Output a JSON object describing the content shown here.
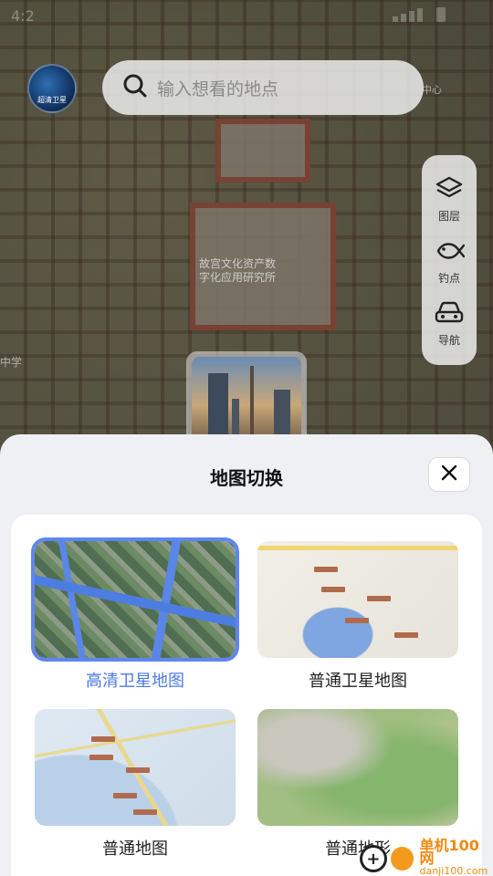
{
  "status": {
    "time": "4:2"
  },
  "map": {
    "label_line1": "故宫文化资产数",
    "label_line2": "字化应用研究所",
    "side_label": "中学",
    "corner_label": "中心"
  },
  "avatar": {
    "label": "超清卫星"
  },
  "search": {
    "placeholder": "输入想看的地点",
    "icon": "search-icon"
  },
  "tools": [
    {
      "label": "图层",
      "icon": "layers-icon"
    },
    {
      "label": "钓点",
      "icon": "fish-icon"
    },
    {
      "label": "导航",
      "icon": "car-icon"
    }
  ],
  "sheet": {
    "title": "地图切换",
    "close_icon": "close-icon",
    "options": [
      {
        "label": "高清卫星地图",
        "selected": true
      },
      {
        "label": "普通卫星地图",
        "selected": false
      },
      {
        "label": "普通地图",
        "selected": false
      },
      {
        "label": "普通地形",
        "selected": false
      }
    ]
  },
  "watermark": {
    "name": "单机100网",
    "url": "danji100.com",
    "logo_char": "+"
  },
  "colors": {
    "accent": "#4d79e6",
    "selected_border": "#5f86f0",
    "watermark": "#f08a12"
  }
}
